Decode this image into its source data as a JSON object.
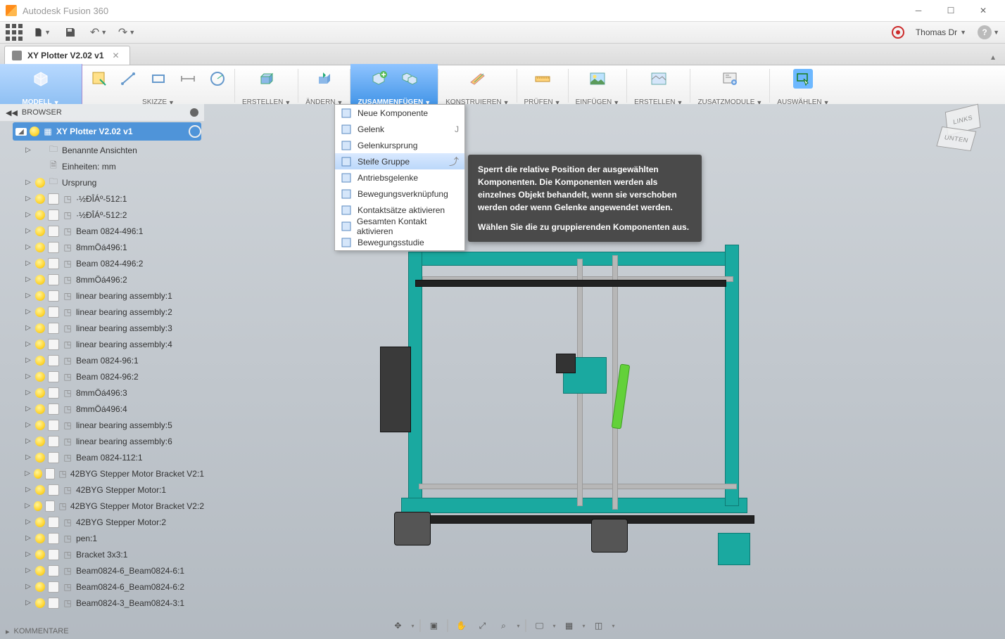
{
  "window": {
    "title": "Autodesk Fusion 360",
    "user": "Thomas Dr"
  },
  "doc": {
    "tab_name": "XY Plotter V2.02 v1"
  },
  "ribbon": {
    "workspace": "MODELL",
    "groups": {
      "sketch": "SKIZZE",
      "create": "ERSTELLEN",
      "modify": "ÄNDERN",
      "assemble": "ZUSAMMENFÜGEN",
      "construct": "KONSTRUIEREN",
      "inspect": "PRÜFEN",
      "insert": "EINFÜGEN",
      "make": "ERSTELLEN",
      "addins": "ZUSATZMODULE",
      "select": "AUSWÄHLEN"
    }
  },
  "dropdown": {
    "items": [
      {
        "label": "Neue Komponente",
        "icon": "new-component"
      },
      {
        "label": "Gelenk",
        "icon": "joint",
        "shortcut": "J"
      },
      {
        "label": "Gelenkursprung",
        "icon": "joint-origin"
      },
      {
        "label": "Steife Gruppe",
        "icon": "rigid-group",
        "hi": true,
        "arrow": true
      },
      {
        "label": "Antriebsgelenke",
        "icon": "drive-joints"
      },
      {
        "label": "Bewegungsverknüpfung",
        "icon": "motion-link"
      },
      {
        "label": "Kontaktsätze aktivieren",
        "icon": "contact-set"
      },
      {
        "label": "Gesamten Kontakt aktivieren",
        "icon": "all-contact"
      },
      {
        "label": "Bewegungsstudie",
        "icon": "motion-study"
      }
    ]
  },
  "tooltip": {
    "p1": "Sperrt die relative Position der ausgewählten Komponenten. Die Komponenten werden als einzelnes Objekt behandelt, wenn sie verschoben werden oder wenn Gelenke angewendet werden.",
    "p2": "Wählen Sie die zu gruppierenden Komponenten aus."
  },
  "browser": {
    "title": "BROWSER",
    "root": "XY Plotter V2.02 v1",
    "items": [
      {
        "label": "Benannte Ansichten",
        "tri": true,
        "bulb": false,
        "chk": false,
        "ico": "folder"
      },
      {
        "label": "Einheiten: mm",
        "tri": false,
        "bulb": false,
        "chk": false,
        "ico": "doc"
      },
      {
        "label": "Ursprung",
        "tri": true,
        "bulb": true,
        "chk": false,
        "ico": "folder"
      },
      {
        "label": "·½ÐÎÁº-512:1",
        "tri": true,
        "bulb": true,
        "chk": true,
        "ico": "comp"
      },
      {
        "label": "·½ÐÎÁº-512:2",
        "tri": true,
        "bulb": true,
        "chk": true,
        "ico": "comp"
      },
      {
        "label": "Beam 0824-496:1",
        "tri": true,
        "bulb": true,
        "chk": true,
        "ico": "comp"
      },
      {
        "label": "8mmÖá496:1",
        "tri": true,
        "bulb": true,
        "chk": true,
        "ico": "comp"
      },
      {
        "label": "Beam 0824-496:2",
        "tri": true,
        "bulb": true,
        "chk": true,
        "ico": "comp"
      },
      {
        "label": "8mmÖá496:2",
        "tri": true,
        "bulb": true,
        "chk": true,
        "ico": "comp"
      },
      {
        "label": "linear bearing assembly:1",
        "tri": true,
        "bulb": true,
        "chk": true,
        "ico": "comp"
      },
      {
        "label": "linear bearing assembly:2",
        "tri": true,
        "bulb": true,
        "chk": true,
        "ico": "comp"
      },
      {
        "label": "linear bearing assembly:3",
        "tri": true,
        "bulb": true,
        "chk": true,
        "ico": "comp"
      },
      {
        "label": "linear bearing assembly:4",
        "tri": true,
        "bulb": true,
        "chk": true,
        "ico": "comp"
      },
      {
        "label": "Beam 0824-96:1",
        "tri": true,
        "bulb": true,
        "chk": true,
        "ico": "comp"
      },
      {
        "label": "Beam 0824-96:2",
        "tri": true,
        "bulb": true,
        "chk": true,
        "ico": "comp"
      },
      {
        "label": "8mmÖá496:3",
        "tri": true,
        "bulb": true,
        "chk": true,
        "ico": "comp"
      },
      {
        "label": "8mmÖá496:4",
        "tri": true,
        "bulb": true,
        "chk": true,
        "ico": "comp"
      },
      {
        "label": "linear bearing assembly:5",
        "tri": true,
        "bulb": true,
        "chk": true,
        "ico": "comp"
      },
      {
        "label": "linear bearing assembly:6",
        "tri": true,
        "bulb": true,
        "chk": true,
        "ico": "comp"
      },
      {
        "label": "Beam 0824-112:1",
        "tri": true,
        "bulb": true,
        "chk": true,
        "ico": "comp"
      },
      {
        "label": "42BYG Stepper Motor Bracket V2:1",
        "tri": true,
        "bulb": true,
        "chk": true,
        "ico": "comp"
      },
      {
        "label": "42BYG Stepper Motor:1",
        "tri": true,
        "bulb": true,
        "chk": true,
        "ico": "comp"
      },
      {
        "label": "42BYG Stepper Motor Bracket V2:2",
        "tri": true,
        "bulb": true,
        "chk": true,
        "ico": "comp"
      },
      {
        "label": "42BYG Stepper Motor:2",
        "tri": true,
        "bulb": true,
        "chk": true,
        "ico": "comp"
      },
      {
        "label": "pen:1",
        "tri": true,
        "bulb": true,
        "chk": true,
        "ico": "comp"
      },
      {
        "label": "Bracket 3x3:1",
        "tri": true,
        "bulb": true,
        "chk": true,
        "ico": "comp"
      },
      {
        "label": "Beam0824-6_Beam0824-6:1",
        "tri": true,
        "bulb": true,
        "chk": true,
        "ico": "comp"
      },
      {
        "label": "Beam0824-6_Beam0824-6:2",
        "tri": true,
        "bulb": true,
        "chk": true,
        "ico": "comp"
      },
      {
        "label": "Beam0824-3_Beam0824-3:1",
        "tri": true,
        "bulb": true,
        "chk": true,
        "ico": "comp"
      }
    ],
    "comments": "KOMMENTARE"
  },
  "viewcube": {
    "face1": "LINKS",
    "face2": "UNTEN"
  }
}
